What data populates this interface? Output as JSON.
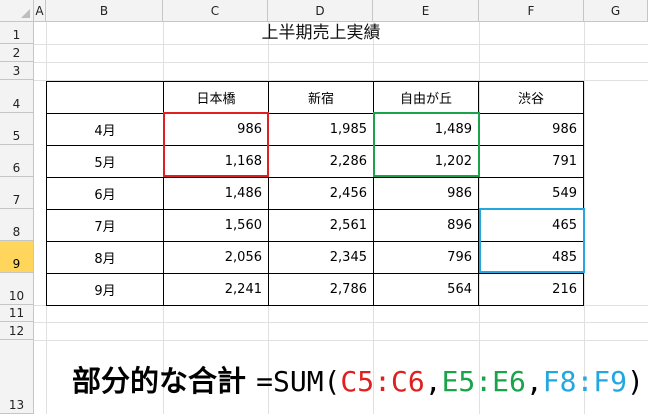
{
  "columns": [
    "A",
    "B",
    "C",
    "D",
    "E",
    "F",
    "G"
  ],
  "rows": [
    "1",
    "2",
    "3",
    "4",
    "5",
    "6",
    "7",
    "8",
    "9",
    "10",
    "11",
    "12",
    "13"
  ],
  "selected_row": "9",
  "title": "上半期売上実績",
  "table": {
    "header": [
      "",
      "日本橋",
      "新宿",
      "自由が丘",
      "渋谷"
    ],
    "rows": [
      [
        "4月",
        "986",
        "1,985",
        "1,489",
        "986"
      ],
      [
        "5月",
        "1,168",
        "2,286",
        "1,202",
        "791"
      ],
      [
        "6月",
        "1,486",
        "2,456",
        "986",
        "549"
      ],
      [
        "7月",
        "1,560",
        "2,561",
        "896",
        "465"
      ],
      [
        "8月",
        "2,056",
        "2,345",
        "796",
        "485"
      ],
      [
        "9月",
        "2,241",
        "2,786",
        "564",
        "216"
      ]
    ]
  },
  "formula": {
    "label": "部分的な合計",
    "prefix": "=SUM(",
    "range1": "C5:C6",
    "sep1": ",",
    "range2": "E5:E6",
    "sep2": ",",
    "range3": "F8:F9",
    "suffix": ")"
  },
  "colors": {
    "range1": "#e02020",
    "range2": "#1aa34a",
    "range3": "#22a7e0",
    "selected_row_header": "#ffd65b"
  }
}
